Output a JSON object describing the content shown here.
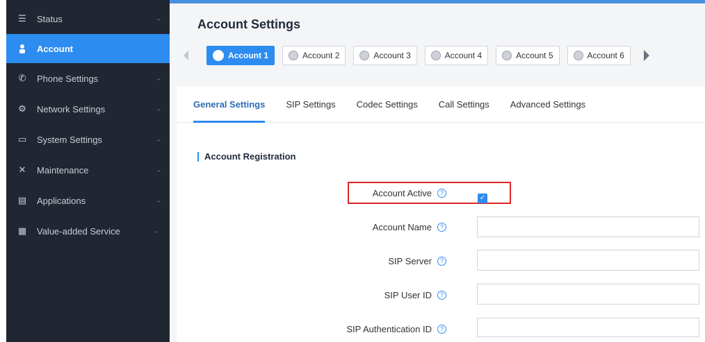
{
  "sidebar": {
    "items": [
      {
        "label": "Status",
        "icon": "list-icon",
        "active": false
      },
      {
        "label": "Account",
        "icon": "person-icon",
        "active": true
      },
      {
        "label": "Phone Settings",
        "icon": "phone-icon",
        "active": false
      },
      {
        "label": "Network Settings",
        "icon": "network-icon",
        "active": false
      },
      {
        "label": "System Settings",
        "icon": "system-icon",
        "active": false
      },
      {
        "label": "Maintenance",
        "icon": "tools-icon",
        "active": false
      },
      {
        "label": "Applications",
        "icon": "document-icon",
        "active": false
      },
      {
        "label": "Value-added Service",
        "icon": "grid-icon",
        "active": false
      }
    ]
  },
  "header": {
    "title": "Account Settings",
    "accounts": [
      "Account 1",
      "Account 2",
      "Account 3",
      "Account 4",
      "Account 5",
      "Account 6"
    ]
  },
  "tabs": [
    "General Settings",
    "SIP Settings",
    "Codec Settings",
    "Call Settings",
    "Advanced Settings"
  ],
  "section": {
    "title": "Account Registration",
    "fields": [
      {
        "label": "Account Active",
        "type": "checkbox",
        "checked": true
      },
      {
        "label": "Account Name",
        "type": "text",
        "value": ""
      },
      {
        "label": "SIP Server",
        "type": "text",
        "value": ""
      },
      {
        "label": "SIP User ID",
        "type": "text",
        "value": ""
      },
      {
        "label": "SIP Authentication ID",
        "type": "text",
        "value": ""
      }
    ]
  },
  "colors": {
    "accent": "#2d8cf0",
    "sidebar": "#202632",
    "highlight": "#e02424"
  }
}
